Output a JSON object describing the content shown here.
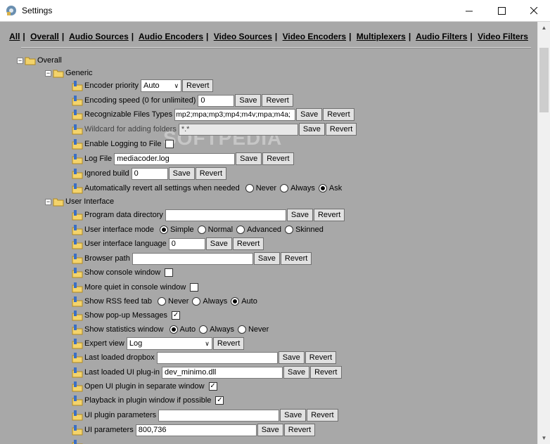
{
  "window": {
    "title": "Settings",
    "minimize": "—",
    "maximize": "☐",
    "close": "✕"
  },
  "nav": [
    "All",
    "Overall",
    "Audio Sources",
    "Audio Encoders",
    "Video Sources",
    "Video Encoders",
    "Multiplexers",
    "Audio Filters",
    "Video Filters"
  ],
  "nav_sep": "|",
  "watermark": "SOFTPEDIA",
  "tree": {
    "overall": "Overall",
    "generic": "Generic",
    "user_interface": "User Interface"
  },
  "buttons": {
    "save": "Save",
    "revert": "Revert"
  },
  "generic": {
    "encoder_priority": {
      "label": "Encoder priority",
      "value": "Auto"
    },
    "encoding_speed": {
      "label": "Encoding speed (0 for unlimited)",
      "value": "0"
    },
    "recognizable_files": {
      "label": "Recognizable Files Types",
      "value": "mp2;mpa;mp3;mp4;m4v;mpa;m4a;"
    },
    "wildcard": {
      "label": "Wildcard for adding folders",
      "value": "*.*"
    },
    "enable_logging": {
      "label": "Enable Logging to File"
    },
    "log_file": {
      "label": "Log File",
      "value": "mediacoder.log"
    },
    "ignored_build": {
      "label": "Ignored build",
      "value": "0"
    },
    "auto_revert": {
      "label": "Automatically revert all settings when needed",
      "options": [
        "Never",
        "Always",
        "Ask"
      ],
      "selected": "Ask"
    }
  },
  "ui": {
    "program_data_dir": {
      "label": "Program data directory",
      "value": ""
    },
    "ui_mode": {
      "label": "User interface mode",
      "options": [
        "Simple",
        "Normal",
        "Advanced",
        "Skinned"
      ],
      "selected": "Simple"
    },
    "ui_language": {
      "label": "User interface language",
      "value": "0"
    },
    "browser_path": {
      "label": "Browser path",
      "value": ""
    },
    "show_console": {
      "label": "Show console window"
    },
    "more_quiet": {
      "label": "More quiet in console window"
    },
    "rss_tab": {
      "label": "Show RSS feed tab",
      "options": [
        "Never",
        "Always",
        "Auto"
      ],
      "selected": "Auto"
    },
    "popup_messages": {
      "label": "Show pop-up Messages",
      "check": "✓"
    },
    "stats_window": {
      "label": "Show statistics window",
      "options": [
        "Auto",
        "Always",
        "Never"
      ],
      "selected": "Auto"
    },
    "expert_view": {
      "label": "Expert view",
      "value": "Log"
    },
    "last_dropbox": {
      "label": "Last loaded dropbox",
      "value": ""
    },
    "last_ui_plugin": {
      "label": "Last loaded UI plug-in",
      "value": "dev_minimo.dll"
    },
    "open_ui_plugin": {
      "label": "Open UI plugin in separate window",
      "check": "✓"
    },
    "playback_plugin": {
      "label": "Playback in plugin window if possible",
      "check": "✓"
    },
    "ui_plugin_params": {
      "label": "UI plugin parameters",
      "value": ""
    },
    "ui_params": {
      "label": "UI parameters",
      "value": "800,736"
    }
  }
}
